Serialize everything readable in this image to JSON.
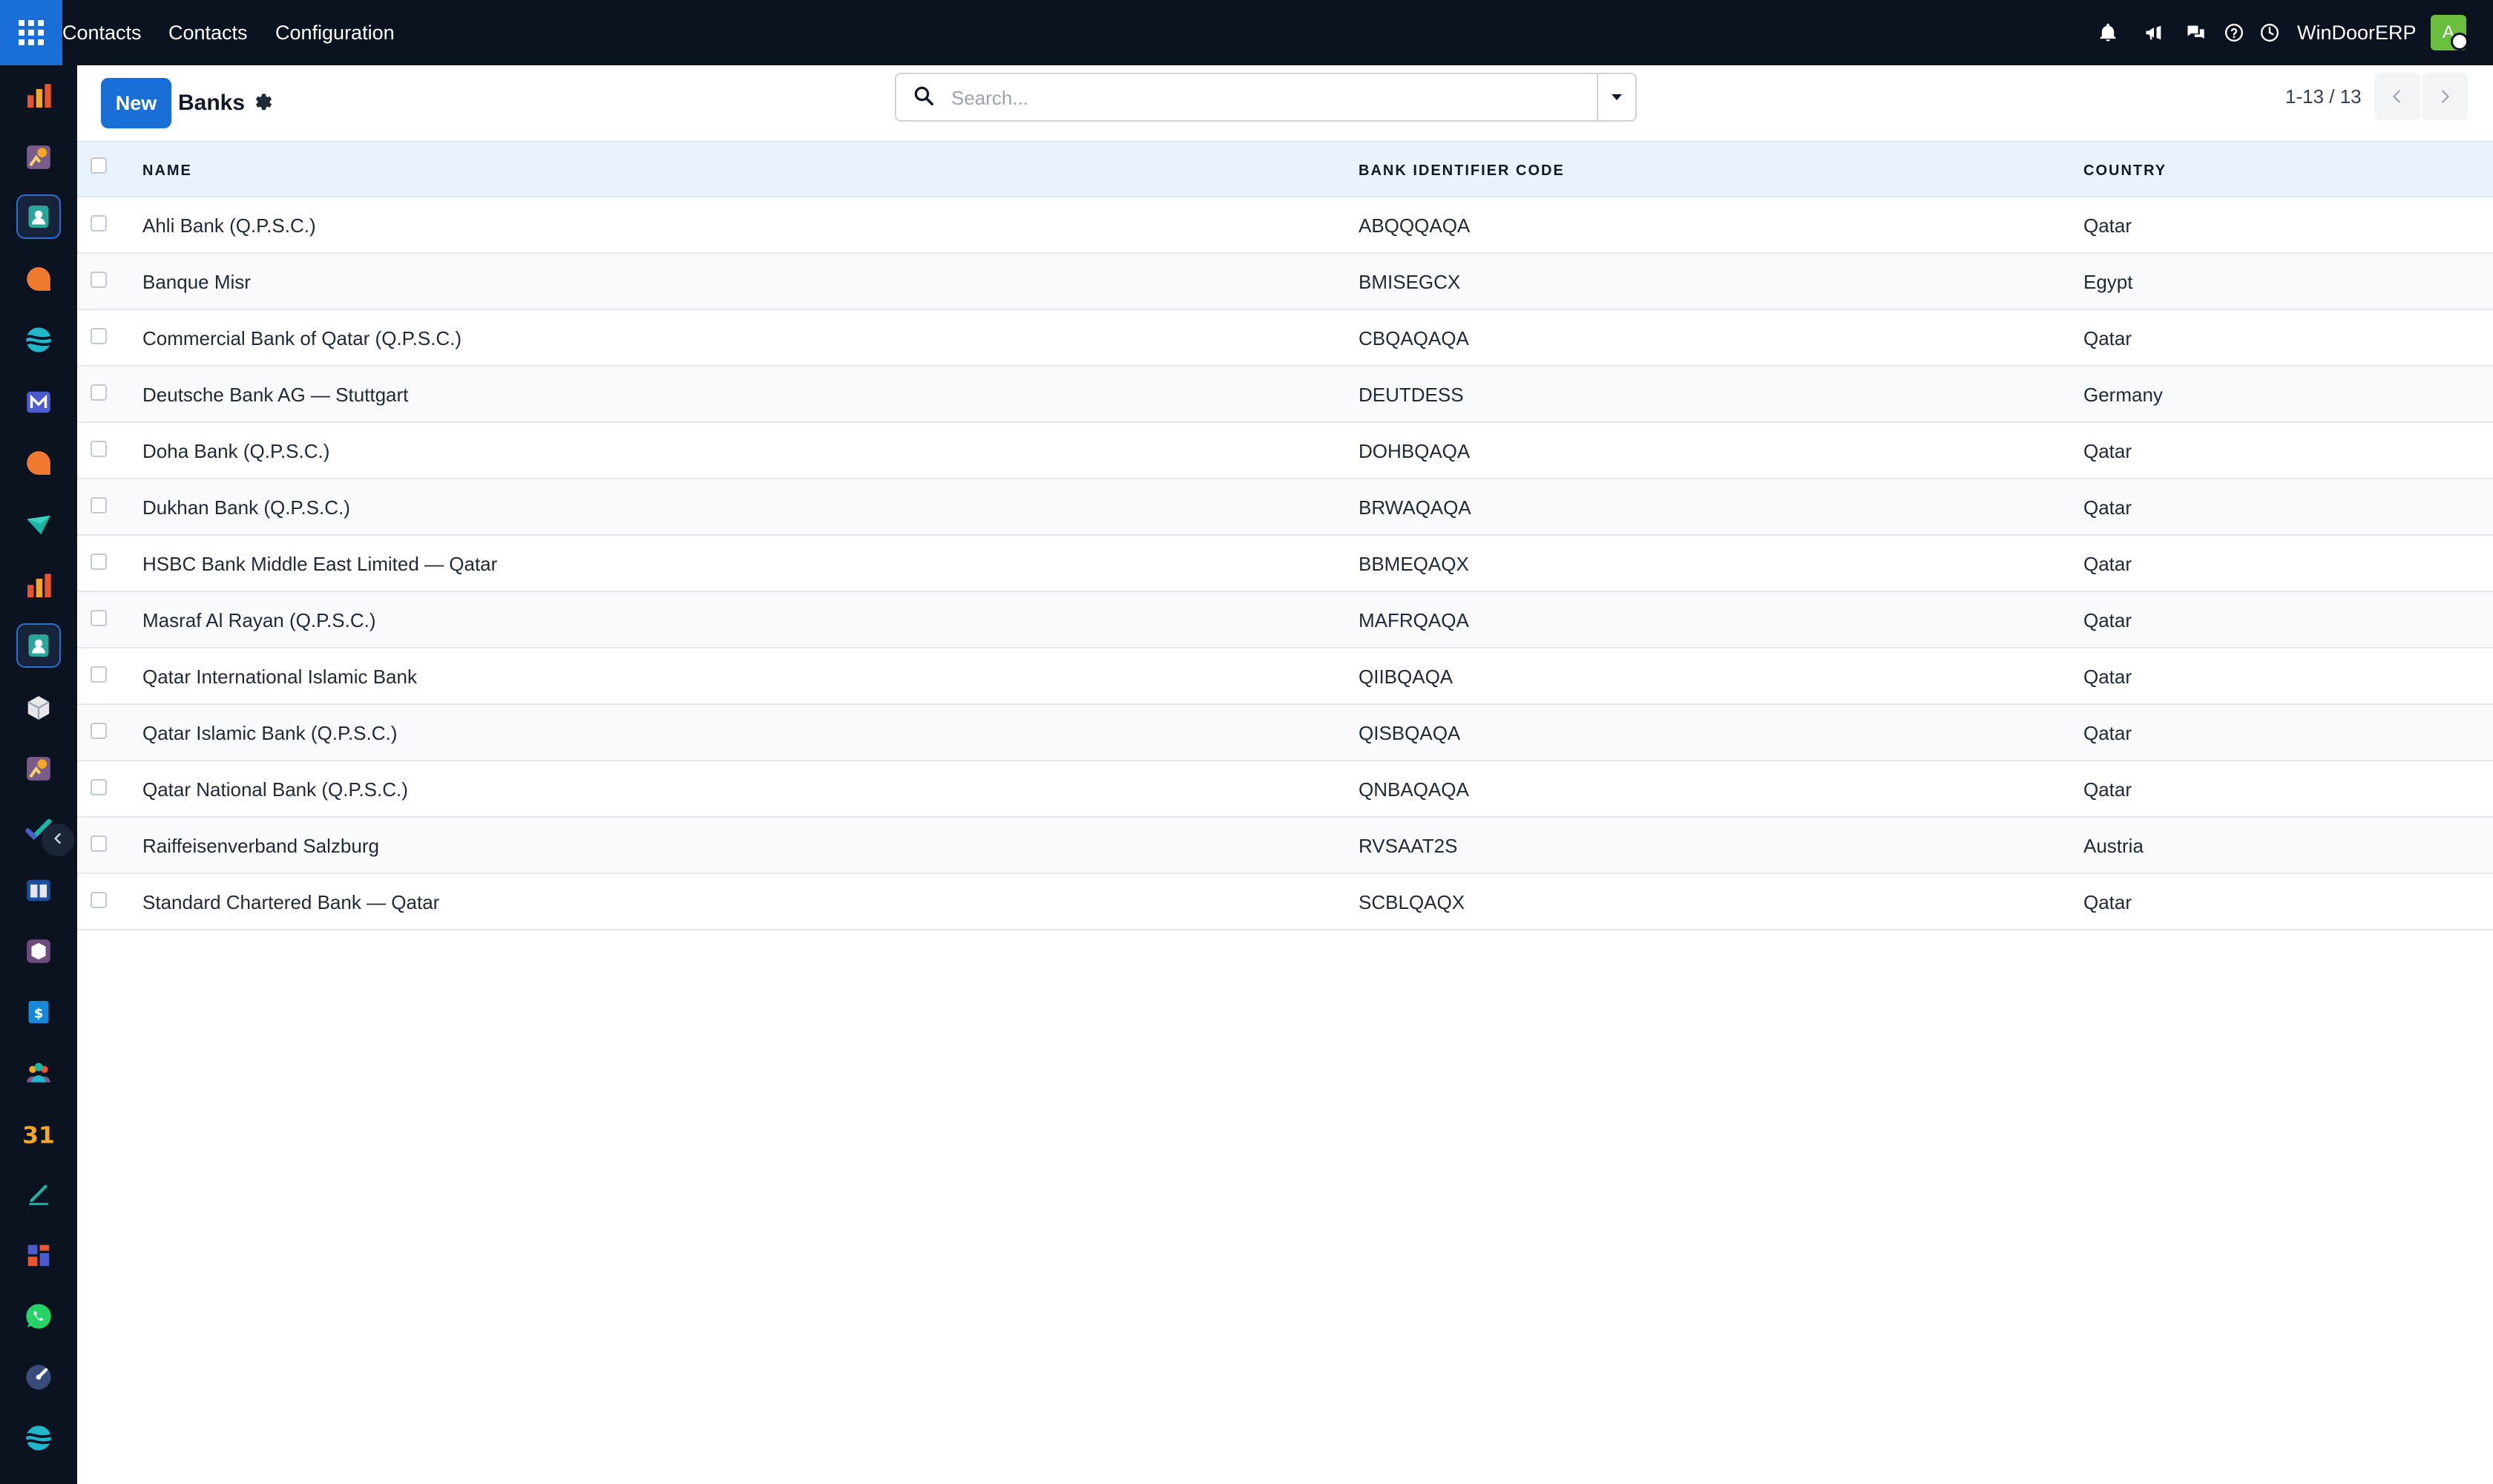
{
  "topbar": {
    "app_name": "Contacts",
    "menu": [
      "Contacts",
      "Configuration"
    ],
    "company": "WinDoorERP",
    "avatar_initial": "A",
    "icons": [
      "bell-icon",
      "megaphone-icon",
      "chat-icon",
      "help-icon",
      "clock-icon"
    ]
  },
  "sidebar": {
    "apps": [
      "dashboards",
      "kpi",
      "contacts",
      "discuss",
      "web",
      "email-marketing",
      "livechat",
      "marketing",
      "reporting",
      "contacts-alt",
      "inventory",
      "kpi-alt",
      "project",
      "knowledge",
      "barcode",
      "invoicing",
      "employees",
      "calendar",
      "sign",
      "dashboard-builder",
      "whatsapp",
      "planning",
      "website"
    ]
  },
  "control_panel": {
    "new_label": "New",
    "title": "Banks",
    "search_placeholder": "Search...",
    "pager": "1-13 / 13"
  },
  "table": {
    "headers": [
      "NAME",
      "BANK IDENTIFIER CODE",
      "COUNTRY"
    ],
    "rows": [
      [
        "Ahli Bank (Q.P.S.C.)",
        "ABQQQAQA",
        "Qatar"
      ],
      [
        "Banque Misr",
        "BMISEGCX",
        "Egypt"
      ],
      [
        "Commercial Bank of Qatar (Q.P.S.C.)",
        "CBQAQAQA",
        "Qatar"
      ],
      [
        "Deutsche Bank AG — Stuttgart",
        "DEUTDESS",
        "Germany"
      ],
      [
        "Doha Bank (Q.P.S.C.)",
        "DOHBQAQA",
        "Qatar"
      ],
      [
        "Dukhan Bank (Q.P.S.C.)",
        "BRWAQAQA",
        "Qatar"
      ],
      [
        "HSBC Bank Middle East Limited — Qatar",
        "BBMEQAQX",
        "Qatar"
      ],
      [
        "Masraf Al Rayan (Q.P.S.C.)",
        "MAFRQAQA",
        "Qatar"
      ],
      [
        "Qatar International Islamic Bank",
        "QIIBQAQA",
        "Qatar"
      ],
      [
        "Qatar Islamic Bank (Q.P.S.C.)",
        "QISBQAQA",
        "Qatar"
      ],
      [
        "Qatar National Bank (Q.P.S.C.)",
        "QNBAQAQA",
        "Qatar"
      ],
      [
        "Raiffeisenverband Salzburg",
        "RVSAAT2S",
        "Austria"
      ],
      [
        "Standard Chartered Bank — Qatar",
        "SCBLQAQX",
        "Qatar"
      ]
    ]
  },
  "colors": {
    "navbar": "#0b1220",
    "primary": "#1a6fd6",
    "header_row": "#e9f2fd",
    "avatar": "#6bbf3e"
  }
}
